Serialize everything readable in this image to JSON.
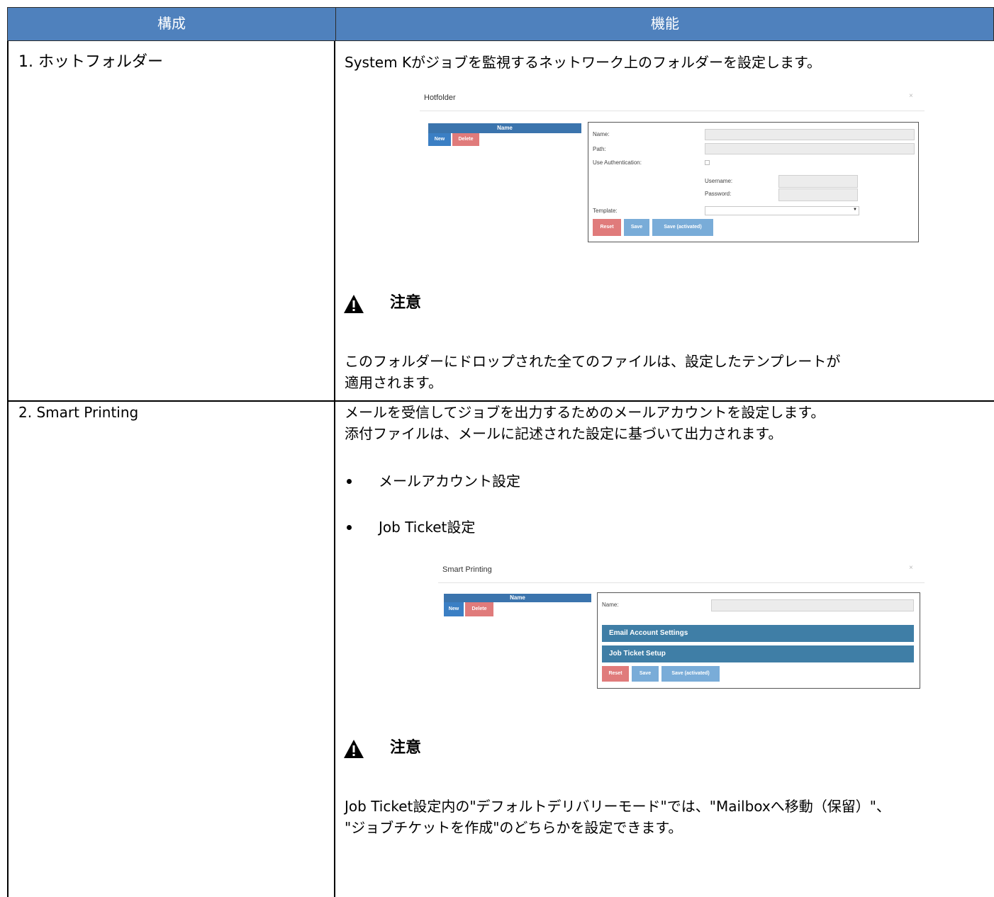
{
  "table": {
    "header": {
      "col1": "構成",
      "col2": "機能"
    },
    "rows": [
      {
        "item": "1. ホットフォルダー",
        "desc": "System Kがジョブを監視するネットワーク上のフォルダーを設定します。",
        "screenshot": {
          "title": "Hotfolder",
          "close": "×",
          "list_header": "Name",
          "new_button": "New",
          "delete_button": "Delete",
          "labels": {
            "name": "Name:",
            "path": "Path:",
            "use_auth": "Use Authentication:",
            "username": "Username:",
            "password": "Password:",
            "template": "Template:"
          },
          "reset_button": "Reset",
          "save_button": "Save",
          "save_activated_button": "Save (activated)"
        },
        "warning": {
          "title": "注意",
          "lines": [
            "このフォルダーにドロップされた全てのファイルは、設定したテンプレートが",
            "適用されます。"
          ]
        }
      },
      {
        "item": "2. Smart Printing",
        "desc_lines": [
          "メールを受信してジョブを出力するためのメールアカウントを設定します。",
          "添付ファイルは、メールに記述された設定に基づいて出力されます。"
        ],
        "bullets": [
          "メールアカウント設定",
          "Job Ticket設定"
        ],
        "screenshot": {
          "title": "Smart Printing",
          "close": "×",
          "list_header": "Name",
          "new_button": "New",
          "delete_button": "Delete",
          "name_label": "Name:",
          "email_section": "Email Account Settings",
          "jobticket_section": "Job Ticket Setup",
          "reset_button": "Reset",
          "save_button": "Save",
          "save_activated_button": "Save (activated)"
        },
        "warning": {
          "title": "注意",
          "lines": [
            "Job Ticket設定内の\"デフォルトデリバリーモード\"では、\"Mailboxへ移動（保留）\"、",
            "\"ジョブチケットを作成\"のどちらかを設定できます。"
          ]
        }
      }
    ]
  }
}
